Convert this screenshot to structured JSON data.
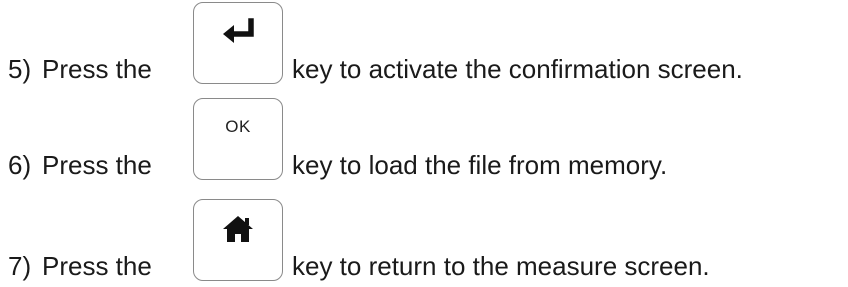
{
  "steps": [
    {
      "number": "5)",
      "press": "Press the",
      "key": {
        "icon": "enter-return-icon"
      },
      "rest": "key to activate the confirmation screen."
    },
    {
      "number": "6)",
      "press": "Press the",
      "key": {
        "label": "OK"
      },
      "rest": "key to load the file from memory."
    },
    {
      "number": "7)",
      "press": "Press the",
      "key": {
        "icon": "home-icon"
      },
      "rest": "key to return to the measure screen."
    }
  ],
  "colors": {
    "text": "#1a1a1a",
    "key_border": "#8a8a8a",
    "icon": "#111111"
  }
}
